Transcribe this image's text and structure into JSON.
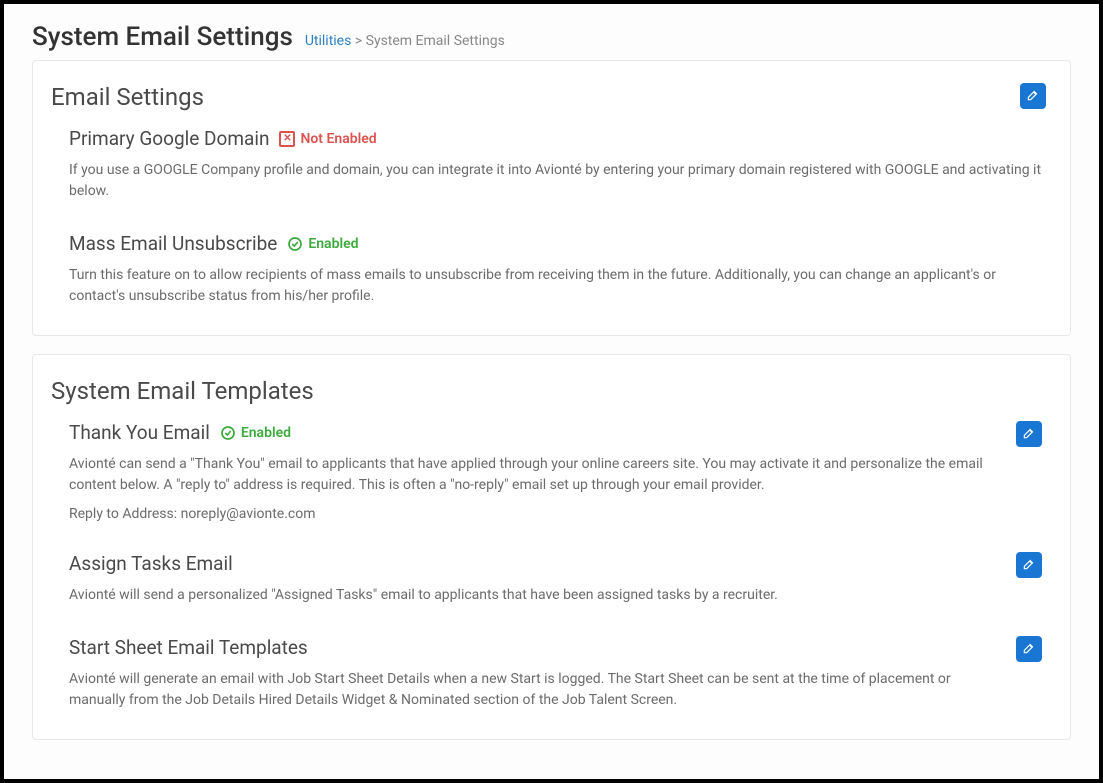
{
  "header": {
    "title": "System Email Settings",
    "breadcrumb_link": "Utilities",
    "breadcrumb_sep": ">",
    "breadcrumb_current": "System Email Settings"
  },
  "emailSettings": {
    "title": "Email Settings",
    "primaryGoogleDomain": {
      "title": "Primary Google Domain",
      "status": "Not Enabled",
      "desc": "If you use a GOOGLE Company profile and domain, you can integrate it into Avionté by entering your primary domain registered with GOOGLE and activating it below."
    },
    "massUnsubscribe": {
      "title": "Mass Email Unsubscribe",
      "status": "Enabled",
      "desc": "Turn this feature on to allow recipients of mass emails to unsubscribe from receiving them in the future. Additionally, you can change an applicant's or contact's unsubscribe status from his/her profile."
    }
  },
  "templates": {
    "title": "System Email Templates",
    "thankYou": {
      "title": "Thank You Email",
      "status": "Enabled",
      "desc": "Avionté can send a \"Thank You\" email to applicants that have applied through your online careers site. You may activate it and personalize the email content below. A \"reply to\" address is required. This is often a \"no-reply\" email set up through your email provider.",
      "replyLabel": "Reply to Address: ",
      "replyValue": "noreply@avionte.com"
    },
    "assignTasks": {
      "title": "Assign Tasks Email",
      "desc": "Avionté will send a personalized \"Assigned Tasks\" email to applicants that have been assigned tasks by a recruiter."
    },
    "startSheet": {
      "title": "Start Sheet Email Templates",
      "desc": "Avionté will generate an email with Job Start Sheet Details when a new Start is logged. The Start Sheet can be sent at the time of placement or manually from the Job Details Hired Details Widget & Nominated section of the Job Talent Screen."
    }
  }
}
